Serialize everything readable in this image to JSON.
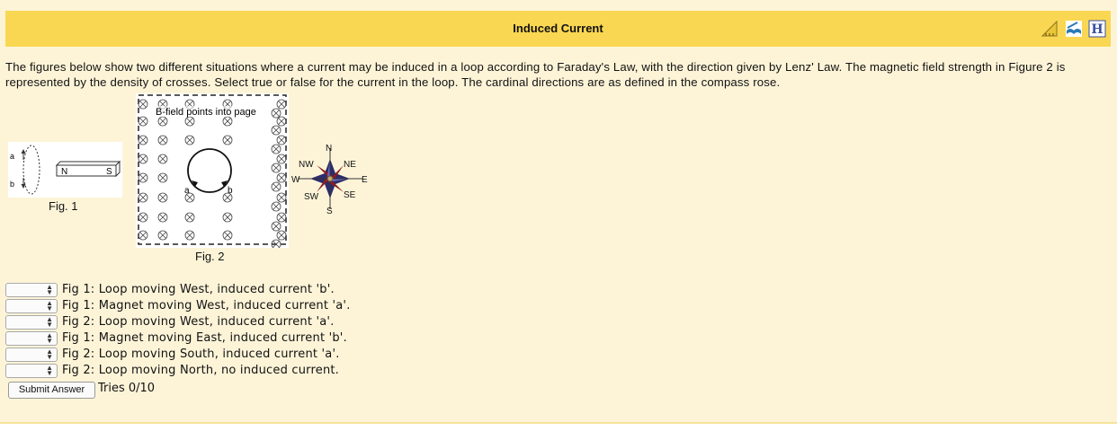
{
  "header": {
    "title": "Induced Current"
  },
  "header_icons": [
    "ruler-triangle-icon",
    "book-icon",
    "hint-h-icon"
  ],
  "intro": "The figures below show two different situations where a current may be induced in a loop according to Faraday's Law, with the direction given by Lenz' Law. The magnetic field strength in Figure 2 is represented by the density of crosses. Select true or false for the current in the loop. The cardinal directions are as defined in the compass rose.",
  "fig1": {
    "caption": "Fig. 1",
    "label_a": "a",
    "label_b": "b",
    "magnet_n": "N",
    "magnet_s": "S"
  },
  "fig2": {
    "caption": "Fig. 2",
    "field_label": "B-field points into page",
    "label_a": "a",
    "label_b": "b"
  },
  "compass": {
    "n": "N",
    "s": "S",
    "e": "E",
    "w": "W",
    "ne": "NE",
    "nw": "NW",
    "se": "SE",
    "sw": "SW"
  },
  "questions": [
    {
      "text": "Fig 1: Loop moving West, induced current 'b'.",
      "selected": ""
    },
    {
      "text": "Fig 1: Magnet moving West, induced current 'a'.",
      "selected": ""
    },
    {
      "text": "Fig 2: Loop moving West, induced current 'a'.",
      "selected": ""
    },
    {
      "text": "Fig 1: Magnet moving East, induced current 'b'.",
      "selected": ""
    },
    {
      "text": "Fig 2: Loop moving South, induced current 'a'.",
      "selected": ""
    },
    {
      "text": "Fig 2: Loop moving North, no induced current.",
      "selected": ""
    }
  ],
  "submit_label": "Submit Answer",
  "tries": "Tries 0/10",
  "colors": {
    "header": "#fad752",
    "panel": "#fdf4d8"
  }
}
